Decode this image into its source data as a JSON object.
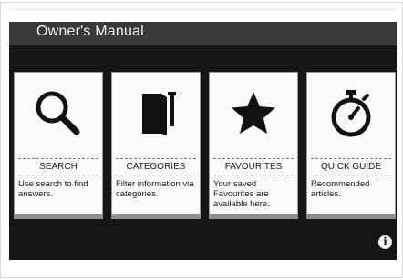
{
  "header": {
    "title": "Owner's Manual"
  },
  "cards": [
    {
      "label": "SEARCH",
      "description": "Use search to find answers.",
      "icon": "search-icon"
    },
    {
      "label": "CATEGORIES",
      "description": "Filter information via categories.",
      "icon": "book-icon"
    },
    {
      "label": "FAVOURITES",
      "description": "Your saved Favourites are available here.",
      "icon": "star-icon"
    },
    {
      "label": "QUICK GUIDE",
      "description": "Recommended articles.",
      "icon": "stopwatch-icon"
    }
  ],
  "info_button": {
    "icon": "info-icon",
    "glyph": "i"
  },
  "colors": {
    "screen_bg": "#161616",
    "header_bg": "#393939",
    "card_bg": "#fbfbfb",
    "card_bar": "#8f8f8f"
  }
}
